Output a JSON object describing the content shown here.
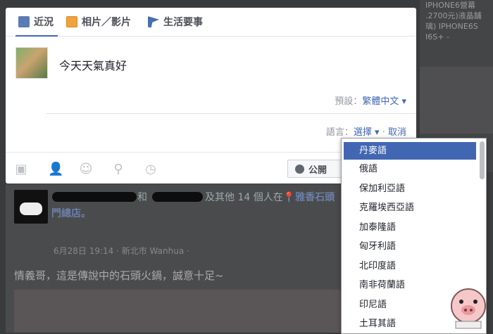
{
  "background_feed": {
    "right_column": [
      "IPHONE6營幕",
      ".2700元)液晶舖",
      "璃) IPHONE6S",
      "I6S+ -"
    ],
    "post": {
      "name_suffix": "和",
      "name_suffix2": "及其他 14 個人在",
      "location": "雅香石頭",
      "location2": "門總店。",
      "meta": "6月28日 19:14 · 新北市 Wanhua · ",
      "text": "情義哥，這是傳說中的石頭火鍋，誠意十足~"
    }
  },
  "composer": {
    "tabs": [
      {
        "label": "近況",
        "icon": "pencil-icon"
      },
      {
        "label": "相片／影片",
        "icon": "photo-icon"
      },
      {
        "label": "生活要事",
        "icon": "flag-icon"
      }
    ],
    "status_text": "今天天氣真好",
    "preset_label": "預設：",
    "preset_value": "繁體中文",
    "language_label": "語言：",
    "language_select": "選擇",
    "cancel": "取消",
    "tools": [
      "camera-icon",
      "tag-people-icon",
      "emoji-icon",
      "location-pin-icon",
      "clock-icon"
    ],
    "privacy_button": "公開"
  },
  "language_dropdown": {
    "selected": "丹麥語",
    "options": [
      "丹麥語",
      "俄語",
      "保加利亞語",
      "克羅埃西亞語",
      "加泰隆語",
      "匈牙利語",
      "北印度語",
      "南非荷蘭語",
      "印尼語",
      "土耳其語"
    ]
  },
  "colors": {
    "accent": "#4267b2"
  }
}
